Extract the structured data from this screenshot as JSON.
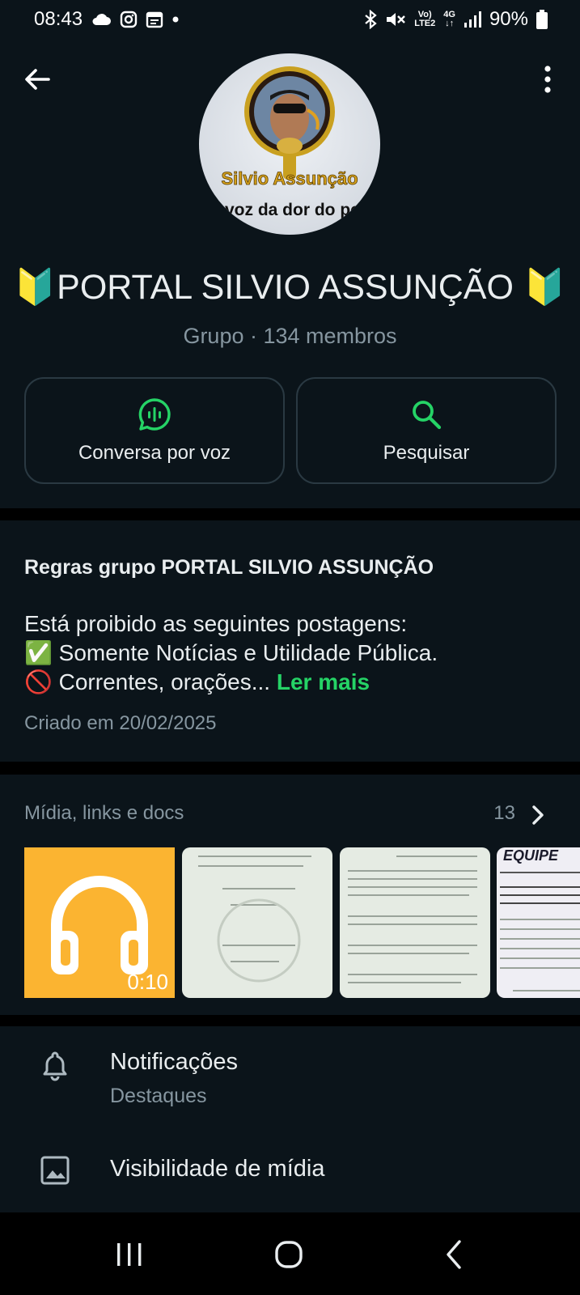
{
  "status_bar": {
    "time": "08:43",
    "volte": "Vo)",
    "lte": "LTE2",
    "network": "4G",
    "battery": "90%",
    "icons": [
      "cloud-icon",
      "instagram-icon",
      "calendar-icon",
      "dot-icon",
      "bluetooth-icon",
      "mute-icon",
      "signal-icon",
      "battery-icon"
    ]
  },
  "header": {
    "title": "🔰PORTAL SILVIO ASSUNÇÃO 🔰",
    "subtitle": "Grupo · 134 membros",
    "avatar_text_line1": "Silvio Assunção",
    "avatar_text_line2": "voz da dor do po"
  },
  "actions": {
    "voice_chat_label": "Conversa por voz",
    "search_label": "Pesquisar"
  },
  "description": {
    "title": "Regras grupo PORTAL SILVIO ASSUNÇÃO",
    "line1": "Está proibido as seguintes postagens:",
    "line2": "✅ Somente Notícias e Utilidade Pública.",
    "line3": "🚫 Correntes, orações...",
    "read_more": "Ler mais",
    "created": "Criado em 20/02/2025"
  },
  "media": {
    "title": "Mídia, links e docs",
    "count": "13",
    "audio_duration": "0:10",
    "doc4_heading": "EQUIPE"
  },
  "settings": {
    "notifications_title": "Notificações",
    "notifications_sub": "Destaques",
    "media_visibility_title": "Visibilidade de mídia"
  },
  "colors": {
    "background": "#0b141a",
    "accent_green": "#25d366",
    "secondary_text": "#8696a0",
    "audio_tile": "#fbb431"
  }
}
